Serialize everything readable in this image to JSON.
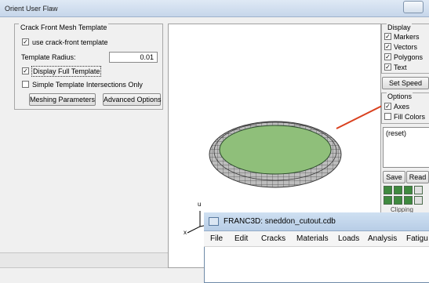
{
  "window": {
    "title": "Orient User Flaw"
  },
  "crack_template": {
    "legend": "Crack Front Mesh Template",
    "use_template": {
      "label": "use crack-front template",
      "checked": true
    },
    "radius_label": "Template Radius:",
    "radius_value": "0.01",
    "display_full": {
      "label": "Display Full Template",
      "checked": true
    },
    "simple_intersections": {
      "label": "Simple Template Intersections Only",
      "checked": false
    },
    "meshing_button": "Meshing Parameters",
    "advanced_button": "Advanced Options"
  },
  "display": {
    "legend": "Display",
    "items": [
      {
        "label": "Markers",
        "checked": true
      },
      {
        "label": "Vectors",
        "checked": true
      },
      {
        "label": "Polygons",
        "checked": true
      },
      {
        "label": "Text",
        "checked": true
      }
    ],
    "set_speed": "Set Speed"
  },
  "options": {
    "legend": "Options",
    "items": [
      {
        "label": "Axes",
        "checked": true
      },
      {
        "label": "Fill Colors",
        "checked": false
      }
    ]
  },
  "list": {
    "items": [
      "(reset)"
    ]
  },
  "buttons": {
    "save": "Save",
    "read": "Read"
  },
  "clipping_label": "Clipping",
  "axes": {
    "up": "u",
    "right": "x"
  },
  "colors": {
    "ring": "#b5b5b5",
    "fill": "#8fbf7a",
    "pointer": "#d9401e"
  },
  "franc3d": {
    "title": "FRANC3D:  sneddon_cutout.cdb",
    "menu": [
      "File",
      "Edit",
      "Cracks",
      "Materials",
      "Loads",
      "Analysis",
      "Fatigu"
    ]
  }
}
